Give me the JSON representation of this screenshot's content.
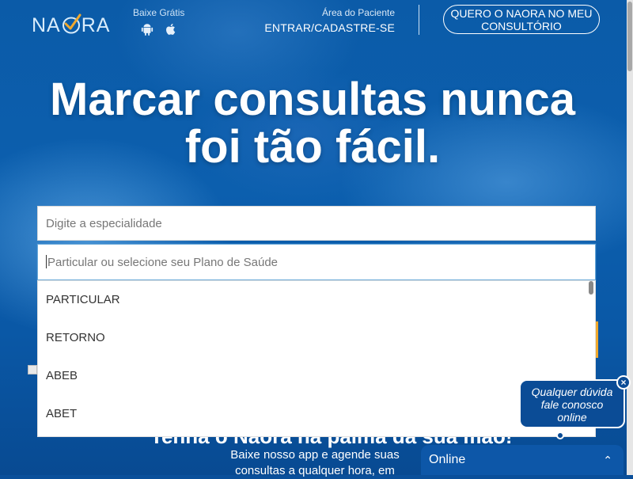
{
  "header": {
    "logo_text_left": "NA",
    "logo_text_right": "RA",
    "download_label": "Baixe Grátis",
    "patient_area_label": "Área do Paciente",
    "patient_login_link": "ENTRAR/CADASTRE-SE",
    "pro_button_line1": "QUERO O NAORA NO MEU",
    "pro_button_line2": "CONSULTÓRIO"
  },
  "hero": {
    "headline_line1": "Marcar consultas nunca",
    "headline_line2": "foi tão fácil."
  },
  "search": {
    "specialty_placeholder": "Digite a especialidade",
    "plan_placeholder": "Particular ou selecione seu Plano de Saúde",
    "plan_options": [
      "PARTICULAR",
      "RETORNO",
      "ABEB",
      "ABET"
    ]
  },
  "promo": {
    "title": "Tenha o Naora na palma da sua mão!",
    "text_line1": "Baixe nosso app e agende suas",
    "text_line2": "consultas a qualquer hora, em"
  },
  "chat": {
    "bubble_line1": "Qualquer dúvida",
    "bubble_line2": "fale conosco",
    "bubble_line3": "online",
    "close_symbol": "×",
    "status_label": "Online",
    "chevron_symbol": "⌃"
  },
  "colors": {
    "brand_blue": "#0b5ba8",
    "chat_blue": "#0b4c96",
    "accent_orange": "#f0a92e",
    "logo_check": "#f0a92e"
  },
  "icons": [
    "android-icon",
    "apple-icon",
    "logo-check-icon",
    "close-icon",
    "chevron-up-icon"
  ]
}
